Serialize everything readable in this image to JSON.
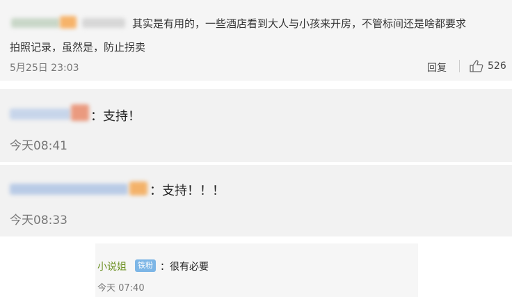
{
  "comment1": {
    "text_line1": "其实是有用的，一些酒店看到大人与小孩来开房，不管标间还是啥都要求",
    "text_line2": "拍照记录，虽然是，防止拐卖",
    "time": "5月25日 23:03",
    "reply_label": "回复",
    "like_count": "526"
  },
  "comment2": {
    "text": "：支持！",
    "time": "今天08:41"
  },
  "comment3": {
    "text": "：支持！！！",
    "time": "今天08:33"
  },
  "comment4": {
    "username": "小说姐",
    "badge": "铁粉",
    "text": "：很有必要",
    "time": "今天 07:40"
  },
  "colors": {
    "username": "#6a8f1f",
    "badge_bg": "#7db6e6",
    "card_bg": "#f2f2f2"
  }
}
